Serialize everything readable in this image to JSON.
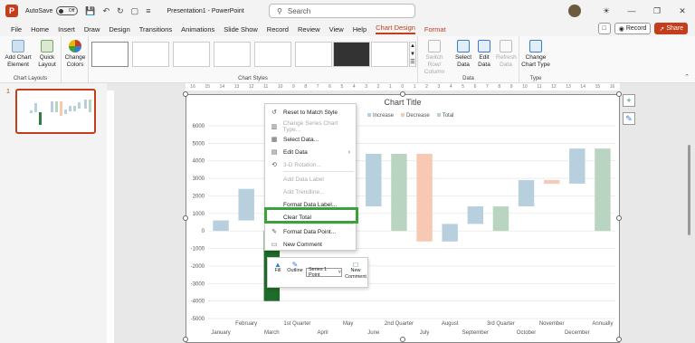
{
  "titlebar": {
    "app_letter": "P",
    "autosave_label": "AutoSave",
    "autosave_state": "Off",
    "doc_title": "Presentation1  -  PowerPoint",
    "search_placeholder": "Search"
  },
  "menubar": {
    "tabs": [
      "File",
      "Home",
      "Insert",
      "Draw",
      "Design",
      "Transitions",
      "Animations",
      "Slide Show",
      "Record",
      "Review",
      "View",
      "Help",
      "Chart Design",
      "Format"
    ],
    "record_label": "Record",
    "share_label": "Share"
  },
  "ribbon": {
    "chart_layouts": {
      "add_chart_element": "Add Chart Element",
      "quick_layout": "Quick Layout",
      "group_label": "Chart Layouts"
    },
    "change_colors": "Change Colors",
    "chart_styles_label": "Chart Styles",
    "data": {
      "switch_row_column": "Switch Row/ Column",
      "select_data": "Select Data",
      "edit_data": "Edit Data",
      "refresh_data": "Refresh Data",
      "group_label": "Data"
    },
    "type": {
      "change_chart_type": "Change Chart Type",
      "group_label": "Type"
    }
  },
  "slide_panel": {
    "slide_number": "1"
  },
  "ruler_ticks": [
    "16",
    "15",
    "14",
    "13",
    "12",
    "11",
    "10",
    "9",
    "8",
    "7",
    "6",
    "5",
    "4",
    "3",
    "2",
    "1",
    "0",
    "1",
    "2",
    "3",
    "4",
    "5",
    "6",
    "7",
    "8",
    "9",
    "10",
    "11",
    "12",
    "13",
    "14",
    "15",
    "16"
  ],
  "chart_data": {
    "type": "waterfall",
    "title": "Chart Title",
    "legend": [
      "Increase",
      "Decrease",
      "Total"
    ],
    "legend_colors": {
      "Increase": "#b8cfdd",
      "Decrease": "#f7c9b4",
      "Total": "#b9d4c0"
    },
    "ylim": [
      -5000,
      6000
    ],
    "yticks": [
      6000,
      5000,
      4000,
      3000,
      2000,
      1000,
      0,
      -1000,
      -2000,
      -3000,
      -4000,
      -5000
    ],
    "categories": [
      "January",
      "February",
      "March",
      "1st Quarter",
      "April",
      "May",
      "June",
      "2nd Quarter",
      "July",
      "August",
      "September",
      "3rd Quarter",
      "October",
      "November",
      "December",
      "Annually"
    ],
    "bars": [
      {
        "label": "January",
        "kind": "Increase",
        "start": 0,
        "end": 600
      },
      {
        "label": "February",
        "kind": "Increase",
        "start": 600,
        "end": 2400
      },
      {
        "label": "March",
        "kind": "Selected",
        "start": 0,
        "end": -4000
      },
      {
        "label": "1st Quarter",
        "kind": "Hidden",
        "start": 0,
        "end": 0
      },
      {
        "label": "April",
        "kind": "Hidden",
        "start": 0,
        "end": 0
      },
      {
        "label": "May",
        "kind": "Hidden",
        "start": 0,
        "end": 0
      },
      {
        "label": "June",
        "kind": "Increase",
        "start": 1400,
        "end": 4400
      },
      {
        "label": "2nd Quarter",
        "kind": "Total",
        "start": 0,
        "end": 4400
      },
      {
        "label": "July",
        "kind": "Decrease",
        "start": 4400,
        "end": -600
      },
      {
        "label": "August",
        "kind": "Increase",
        "start": -600,
        "end": 400
      },
      {
        "label": "September",
        "kind": "Increase",
        "start": 400,
        "end": 1400
      },
      {
        "label": "3rd Quarter",
        "kind": "Total",
        "start": 0,
        "end": 1400
      },
      {
        "label": "October",
        "kind": "Increase",
        "start": 1400,
        "end": 2900
      },
      {
        "label": "November",
        "kind": "Decrease",
        "start": 2900,
        "end": 2700
      },
      {
        "label": "December",
        "kind": "Increase",
        "start": 2700,
        "end": 4700
      },
      {
        "label": "Annually",
        "kind": "Total",
        "start": 0,
        "end": 4700
      }
    ]
  },
  "context_menu": {
    "items": [
      {
        "label": "Reset to Match Style",
        "icon": "reset-icon",
        "disabled": false
      },
      {
        "label": "Change Series Chart Type...",
        "icon": "chart-type-icon",
        "disabled": true
      },
      {
        "label": "Select Data...",
        "icon": "select-data-icon",
        "disabled": false
      },
      {
        "label": "Edit Data",
        "icon": "edit-data-icon",
        "disabled": false,
        "submenu": true
      },
      {
        "label": "3-D Rotation...",
        "icon": "rotate-icon",
        "disabled": true
      },
      {
        "label": "Add Data Label",
        "icon": "",
        "disabled": true
      },
      {
        "label": "Add Trendline...",
        "icon": "",
        "disabled": true
      },
      {
        "label": "Format Data Label...",
        "icon": "",
        "disabled": false
      },
      {
        "label": "Clear Total",
        "icon": "",
        "disabled": false
      },
      {
        "label": "Format Data Point...",
        "icon": "format-icon",
        "disabled": false
      },
      {
        "label": "New Comment",
        "icon": "comment-icon",
        "disabled": false
      }
    ]
  },
  "mini_toolbar": {
    "fill": "Fill",
    "outline": "Outline",
    "series_select": "Series 1 Point",
    "new_comment": "New Comment"
  }
}
